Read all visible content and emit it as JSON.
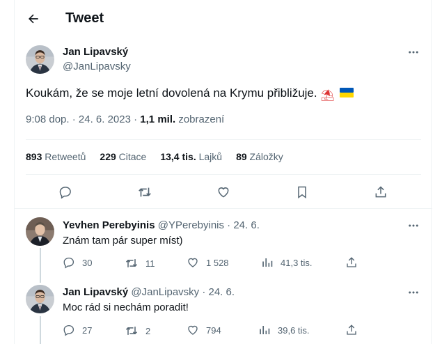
{
  "header": {
    "title": "Tweet"
  },
  "tweet": {
    "author_name": "Jan Lipavský",
    "author_handle": "@JanLipavsky",
    "text": "Koukám, že se moje letní dovolená na Krymu přibližuje.",
    "emoji_umbrella": "⛱",
    "time": "9:08 dop. · 24. 6. 2023 · ",
    "views_count": "1,1 mil.",
    "views_label": " zobrazení",
    "stats": {
      "retweets_count": "893",
      "retweets_label": " Retweetů",
      "quotes_count": "229",
      "quotes_label": " Citace",
      "likes_count": "13,4 tis.",
      "likes_label": " Lajků",
      "bookmarks_count": "89",
      "bookmarks_label": " Záložky"
    }
  },
  "replies": [
    {
      "name": "Yevhen Perebyinis",
      "handle_date": " @YPerebyinis · 24. 6.",
      "text": "Znám tam pár super míst)",
      "replies": "30",
      "retweets": "11",
      "likes": "1 528",
      "views": "41,3 tis."
    },
    {
      "name": "Jan Lipavský",
      "handle_date": " @JanLipavsky · 24. 6.",
      "text": "Moc rád si nechám poradit!",
      "replies": "27",
      "retweets": "2",
      "likes": "794",
      "views": "39,6 tis."
    }
  ],
  "colors": {
    "text": "#0f1419",
    "secondary": "#536471",
    "divider": "#eff3f4",
    "ukraine_blue": "#0057b7",
    "ukraine_yellow": "#ffd700"
  },
  "icons": [
    "back-arrow-icon",
    "more-icon",
    "reply-icon",
    "retweet-icon",
    "like-icon",
    "bookmark-icon",
    "share-icon",
    "views-icon",
    "beach-umbrella-icon",
    "ukraine-flag-icon"
  ]
}
